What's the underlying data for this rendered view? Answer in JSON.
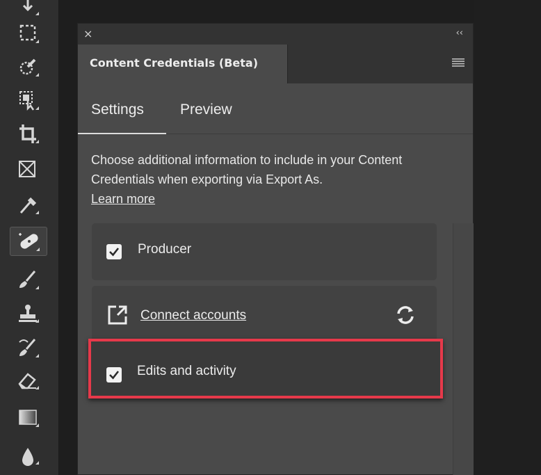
{
  "panel": {
    "close_glyph": "×",
    "collapse_glyph": "‹‹",
    "title": "Content Credentials (Beta)",
    "menu_icon": "hamburger-icon"
  },
  "subtabs": [
    {
      "label": "Settings",
      "active": true
    },
    {
      "label": "Preview",
      "active": false
    }
  ],
  "description": {
    "text": "Choose additional information to include in your Content Credentials when exporting via Export As.",
    "link": "Learn more"
  },
  "options": {
    "producer": {
      "label": "Producer",
      "checked": true
    },
    "connect": {
      "label": "Connect accounts",
      "link_icon": "external-link-icon",
      "refresh_icon": "refresh-icon"
    },
    "edits": {
      "label": "Edits and activity",
      "checked": true
    }
  },
  "tools": [
    "move-tool-icon",
    "marquee-tool-icon",
    "quick-selection-tool-icon",
    "object-selection-tool-icon",
    "crop-tool-icon",
    "frame-tool-icon",
    "eyedropper-tool-icon",
    "spot-healing-brush-tool-icon",
    "brush-tool-icon",
    "clone-stamp-tool-icon",
    "history-brush-tool-icon",
    "eraser-tool-icon",
    "gradient-tool-icon",
    "blur-tool-icon"
  ],
  "colors": {
    "highlight": "#e6394a",
    "panel_bg": "#4a4a4a",
    "card_bg": "#424242",
    "toolbar_bg": "#2f2f2f"
  }
}
